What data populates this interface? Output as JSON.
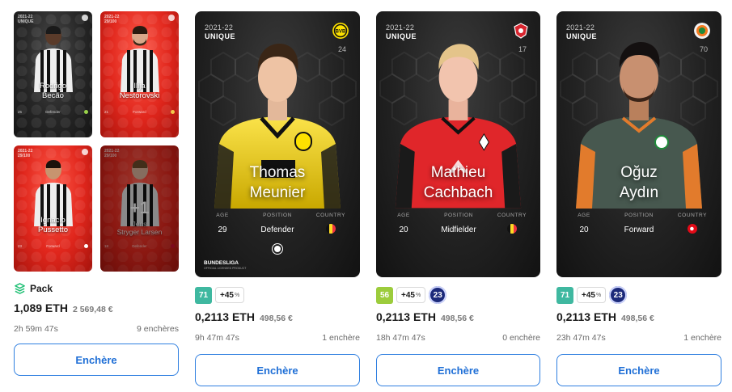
{
  "pack": {
    "cards": [
      {
        "name_line1": "Rodrigo",
        "name_line2": "Becão",
        "position": "Defender",
        "number": "25",
        "season": "2021-22",
        "rarity": "UNIQUE",
        "style": "dark"
      },
      {
        "name_line1": "Ilija",
        "name_line2": "Nestorovski",
        "position": "Forward",
        "number": "21",
        "season": "2021-22",
        "rarity": "29/100",
        "style": "red"
      },
      {
        "name_line1": "Ignacio",
        "name_line2": "Pussetto",
        "position": "Forward",
        "number": "23",
        "season": "2021-22",
        "rarity": "29/100",
        "style": "red"
      },
      {
        "name_line1": "Jens",
        "name_line2": "Stryger Larsen",
        "position": "Defender",
        "number": "18",
        "season": "2021-22",
        "rarity": "29/100",
        "style": "red-dim"
      }
    ],
    "more_overlay": "+1",
    "label": "Pack",
    "price_eth": "1,089 ETH",
    "price_eur": "2 569,48 €",
    "time_left": "2h 59m 47s",
    "bids": "9 enchères",
    "button_label": "Enchère"
  },
  "cards": [
    {
      "season": "2021-22",
      "rarity": "UNIQUE",
      "jersey_number": "24",
      "name_line1": "Thomas",
      "name_line2": "Meunier",
      "stats": {
        "age_label": "AGE",
        "age": "29",
        "position_label": "POSITION",
        "position": "Defender",
        "country_label": "COUNTRY"
      },
      "country_flag": "belgium",
      "league": "BUNDESLIGA",
      "league_sub": "OFFICIAL LICENSED PRODUCT",
      "score": "71",
      "score_color": "#3fb8a0",
      "bonus": "+45",
      "bonus_unit": "%",
      "xp": "",
      "price_eth": "0,2113 ETH",
      "price_eur": "498,56 €",
      "time_left": "9h 47m 47s",
      "bids": "1 enchère",
      "button_label": "Enchère"
    },
    {
      "season": "2021-22",
      "rarity": "UNIQUE",
      "jersey_number": "17",
      "name_line1": "Mathieu",
      "name_line2": "Cachbach",
      "stats": {
        "age_label": "AGE",
        "age": "20",
        "position_label": "POSITION",
        "position": "Midfielder",
        "country_label": "COUNTRY"
      },
      "country_flag": "belgium",
      "score": "56",
      "score_color": "#9ccc3c",
      "bonus": "+45",
      "bonus_unit": "%",
      "xp": "23",
      "price_eth": "0,2113 ETH",
      "price_eur": "498,56 €",
      "time_left": "18h 47m 47s",
      "bids": "0 enchère",
      "button_label": "Enchère"
    },
    {
      "season": "2021-22",
      "rarity": "UNIQUE",
      "jersey_number": "70",
      "name_line1": "Oğuz",
      "name_line2": "Aydın",
      "stats": {
        "age_label": "AGE",
        "age": "20",
        "position_label": "POSITION",
        "position": "Forward",
        "country_label": "COUNTRY"
      },
      "country_flag": "turkey",
      "score": "71",
      "score_color": "#3fb8a0",
      "bonus": "+45",
      "bonus_unit": "%",
      "xp": "23",
      "price_eth": "0,2113 ETH",
      "price_eur": "498,56 €",
      "time_left": "23h 47m 47s",
      "bids": "1 enchère",
      "button_label": "Enchère"
    }
  ],
  "colors": {
    "accent": "#1f6fd6",
    "pack_icon": "#1dbf73",
    "xp_badge": "#1c2a7a"
  },
  "icons": {
    "pack": "pack-icon",
    "ball": "ball-icon"
  }
}
